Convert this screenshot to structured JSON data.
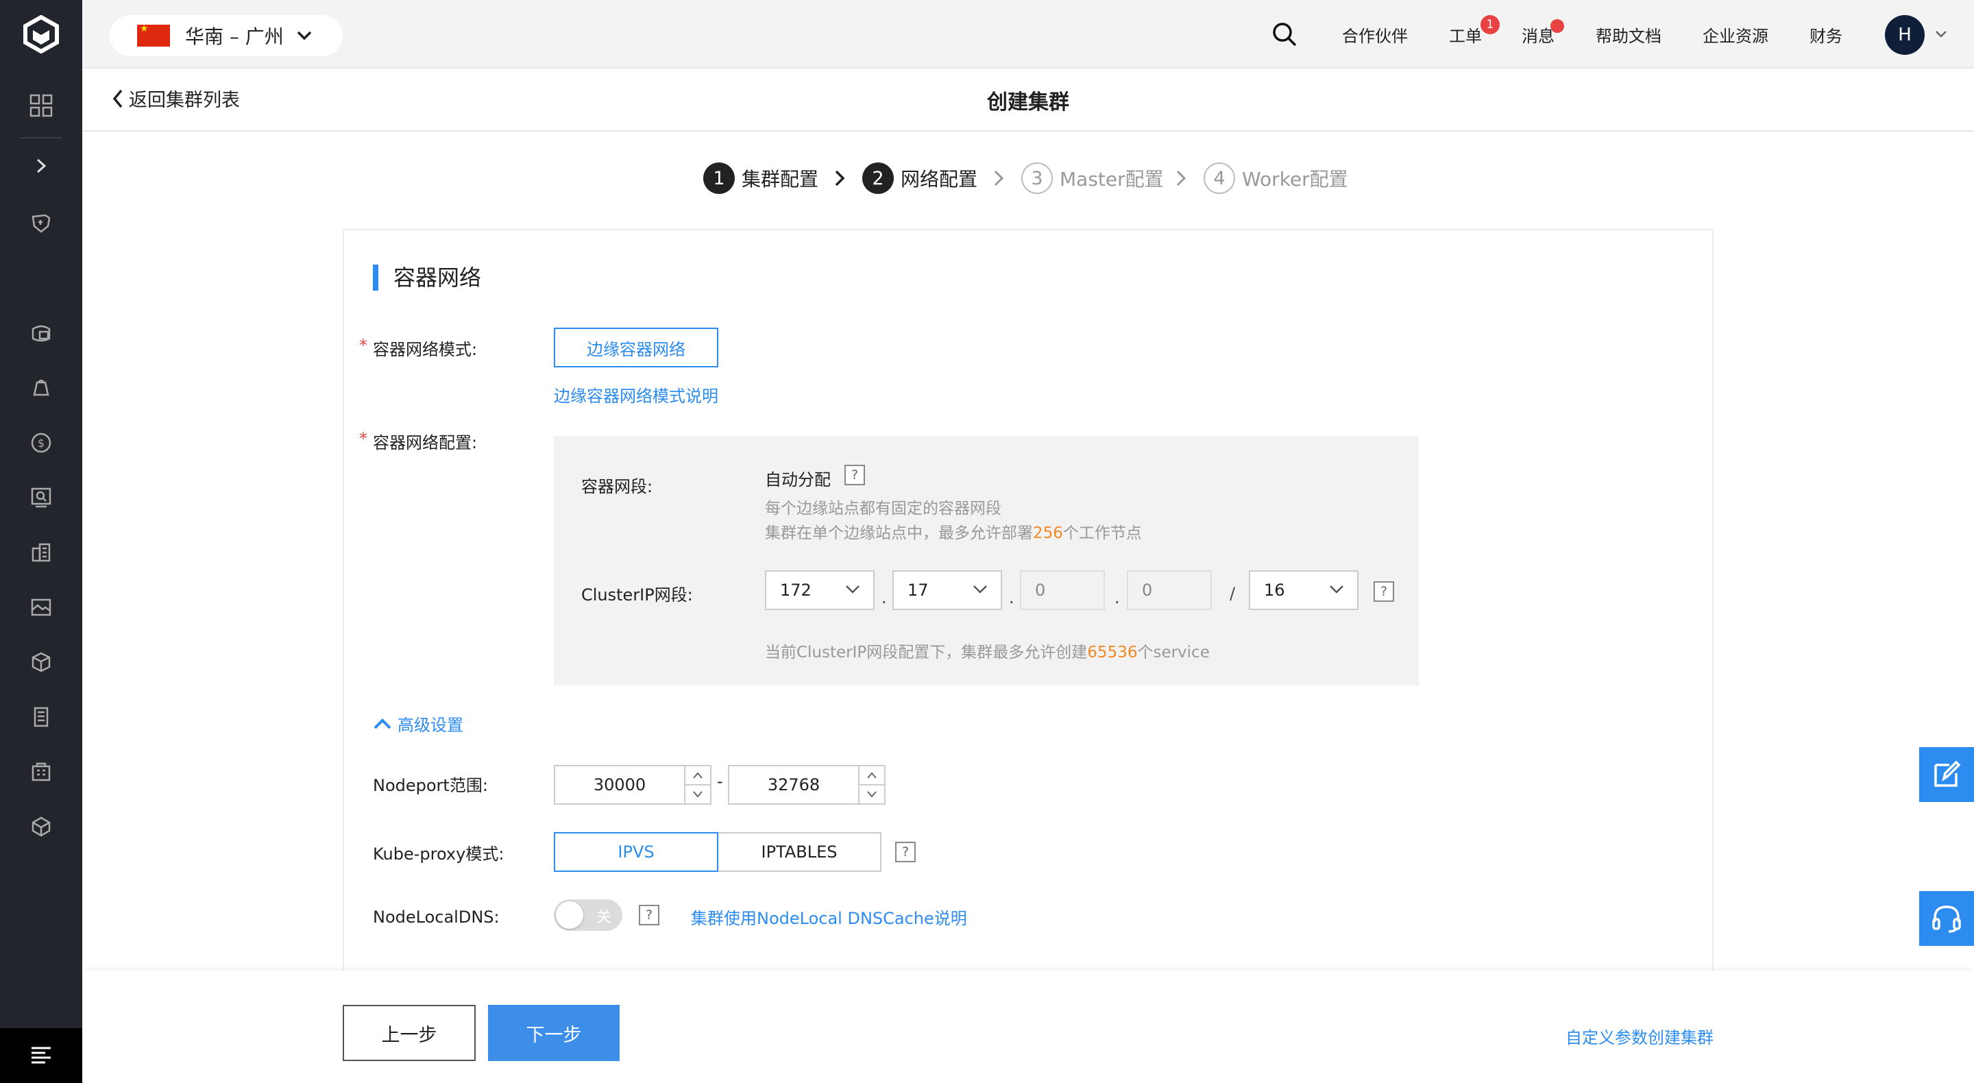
{
  "topbar": {
    "region": "华南 – 广州",
    "nav": {
      "partners": "合作伙伴",
      "tickets": "工单",
      "tickets_badge": "1",
      "messages": "消息",
      "docs": "帮助文档",
      "enterprise": "企业资源",
      "finance": "财务"
    },
    "avatar": "H"
  },
  "header": {
    "back": "返回集群列表",
    "title": "创建集群"
  },
  "steps": [
    {
      "num": "1",
      "label": "集群配置",
      "state": "done"
    },
    {
      "num": "2",
      "label": "网络配置",
      "state": "active"
    },
    {
      "num": "3",
      "label": "Master配置",
      "state": "todo"
    },
    {
      "num": "4",
      "label": "Worker配置",
      "state": "todo"
    }
  ],
  "section": {
    "title": "容器网络",
    "mode_label": "容器网络模式:",
    "mode_button": "边缘容器网络",
    "mode_link": "边缘容器网络模式说明",
    "config_label": "容器网络配置:",
    "cidr_label": "容器网段:",
    "cidr_value": "自动分配",
    "cidr_hint1": "每个边缘站点都有固定的容器网段",
    "cidr_hint2_pre": "集群在单个边缘站点中，最多允许部署",
    "cidr_hint2_num": "256",
    "cidr_hint2_post": "个工作节点",
    "clusterip_label": "ClusterIP网段:",
    "clusterip": {
      "o1": "172",
      "o2": "17",
      "o3": "0",
      "o4": "0",
      "sep_dot": ".",
      "sep_slash": "/",
      "mask": "16"
    },
    "clusterip_hint_pre": "当前ClusterIP网段配置下，集群最多允许创建",
    "clusterip_hint_num": "65536",
    "clusterip_hint_post": "个service",
    "help_mark": "?"
  },
  "advanced": {
    "toggle_label": "高级设置",
    "nodeport_label": "Nodeport范围:",
    "nodeport_min": "30000",
    "nodeport_sep": "-",
    "nodeport_max": "32768",
    "kubeproxy_label": "Kube-proxy模式:",
    "kubeproxy_ipvs": "IPVS",
    "kubeproxy_iptables": "IPTABLES",
    "nodelocal_label": "NodeLocalDNS:",
    "nodelocal_state": "关",
    "nodelocal_link": "集群使用NodeLocal DNSCache说明"
  },
  "footer": {
    "prev": "上一步",
    "next": "下一步",
    "custom": "自定义参数创建集群"
  },
  "colors": {
    "accent": "#2d8cf0",
    "sidebar": "#22252b",
    "highlight": "#f08a24"
  }
}
